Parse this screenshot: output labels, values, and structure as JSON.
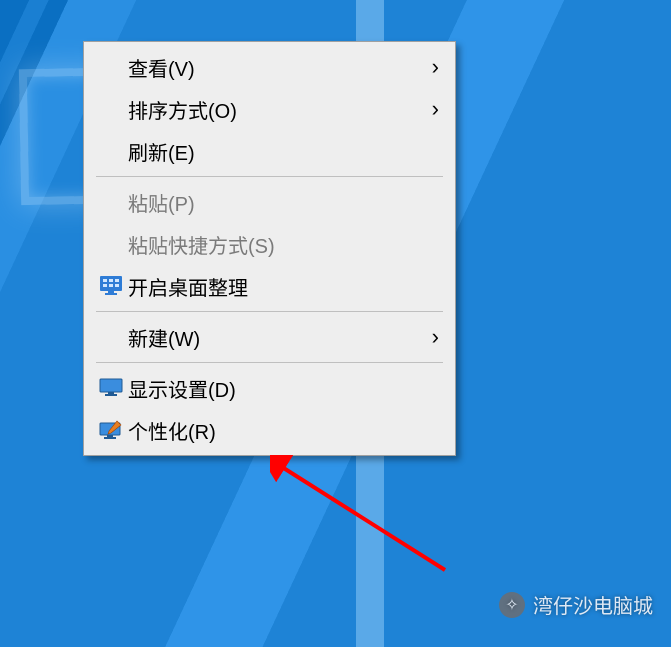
{
  "context_menu": {
    "items": [
      {
        "label": "查看(V)",
        "has_submenu": true,
        "disabled": false,
        "icon": null,
        "name": "menu-view"
      },
      {
        "label": "排序方式(O)",
        "has_submenu": true,
        "disabled": false,
        "icon": null,
        "name": "menu-sort-by"
      },
      {
        "label": "刷新(E)",
        "has_submenu": false,
        "disabled": false,
        "icon": null,
        "name": "menu-refresh"
      },
      {
        "separator": true
      },
      {
        "label": "粘贴(P)",
        "has_submenu": false,
        "disabled": true,
        "icon": null,
        "name": "menu-paste"
      },
      {
        "label": "粘贴快捷方式(S)",
        "has_submenu": false,
        "disabled": true,
        "icon": null,
        "name": "menu-paste-shortcut"
      },
      {
        "label": "开启桌面整理",
        "has_submenu": false,
        "disabled": false,
        "icon": "grid",
        "name": "menu-desktop-organizer"
      },
      {
        "separator": true
      },
      {
        "label": "新建(W)",
        "has_submenu": true,
        "disabled": false,
        "icon": null,
        "name": "menu-new"
      },
      {
        "separator": true
      },
      {
        "label": "显示设置(D)",
        "has_submenu": false,
        "disabled": false,
        "icon": "monitor",
        "name": "menu-display-settings"
      },
      {
        "label": "个性化(R)",
        "has_submenu": false,
        "disabled": false,
        "icon": "brush",
        "name": "menu-personalize"
      }
    ]
  },
  "watermark": {
    "text": "湾仔沙电脑城",
    "icon_glyph": "✧"
  }
}
